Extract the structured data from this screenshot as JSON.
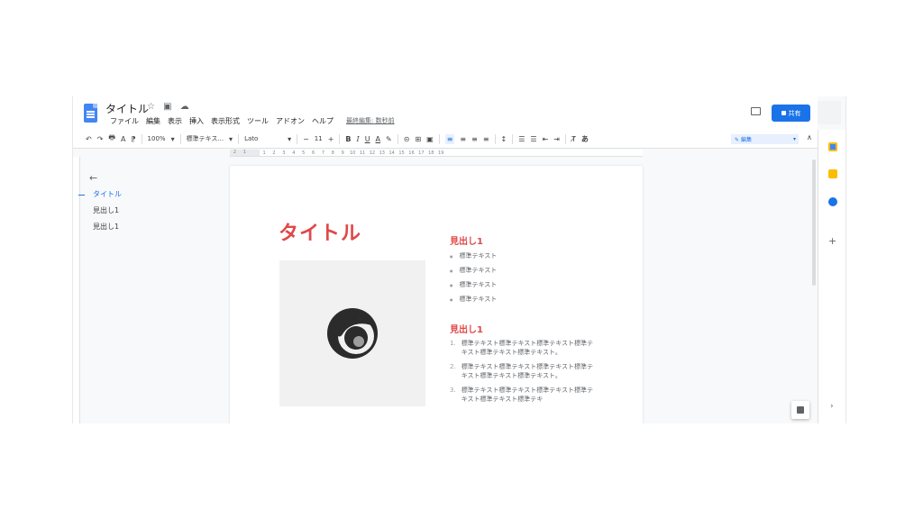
{
  "header": {
    "title": "タイトル",
    "title_icons": "☆ ▣ ☁",
    "menu": [
      "ファイル",
      "編集",
      "表示",
      "挿入",
      "表示形式",
      "ツール",
      "アドオン",
      "ヘルプ"
    ],
    "last_edit": "最終編集: 数秒前",
    "share_label": "共有"
  },
  "toolbar": {
    "undo": "↶",
    "redo": "↷",
    "print": "🖶",
    "spell": "A",
    "paint": "⁋",
    "zoom": "100%",
    "style": "標準テキス...",
    "font": "Lato",
    "font_size": "11",
    "minus": "−",
    "plus": "+",
    "bold": "B",
    "italic": "I",
    "underline": "U",
    "text_color": "A",
    "highlight": "✎",
    "link": "⊝",
    "comment": "⊞",
    "image": "▣",
    "align_left": "≡",
    "align_center": "≡",
    "align_right": "≡",
    "align_justify": "≡",
    "line_spacing": "↕",
    "checklist": "☰",
    "bullets": "☰",
    "indent_dec": "⇤",
    "indent_inc": "⇥",
    "clear_format": "T̸",
    "input_tool": "あ",
    "mode_label": "編集",
    "collapse": "∧"
  },
  "ruler": [
    "2",
    "1",
    "",
    "1",
    "2",
    "3",
    "4",
    "5",
    "6",
    "7",
    "8",
    "9",
    "10",
    "11",
    "12",
    "13",
    "14",
    "15",
    "16",
    "17",
    "18",
    "19"
  ],
  "outline": {
    "back": "←",
    "items": [
      {
        "label": "タイトル",
        "active": true
      },
      {
        "label": "見出し1",
        "active": false
      },
      {
        "label": "見出し1",
        "active": false
      }
    ]
  },
  "document": {
    "title": "タイトル",
    "heading1": "見出し1",
    "bullets": [
      "標準テキスト",
      "標準テキスト",
      "標準テキスト",
      "標準テキスト"
    ],
    "heading2": "見出し1",
    "numbered": [
      {
        "num": "1.",
        "text": "標準テキスト標準テキスト標準テキスト標準テキスト標準テキスト標準テキスト。"
      },
      {
        "num": "2.",
        "text": "標準テキスト標準テキスト標準テキスト標準テキスト標準テキスト標準テキスト。"
      },
      {
        "num": "3.",
        "text": "標準テキスト標準テキスト標準テキスト標準テキスト標準テキスト標準テキ"
      }
    ]
  },
  "sidepanel": {
    "plus": "+",
    "chevron": "›"
  },
  "colors": {
    "accent": "#1a73e8",
    "title_red": "#e04848"
  }
}
